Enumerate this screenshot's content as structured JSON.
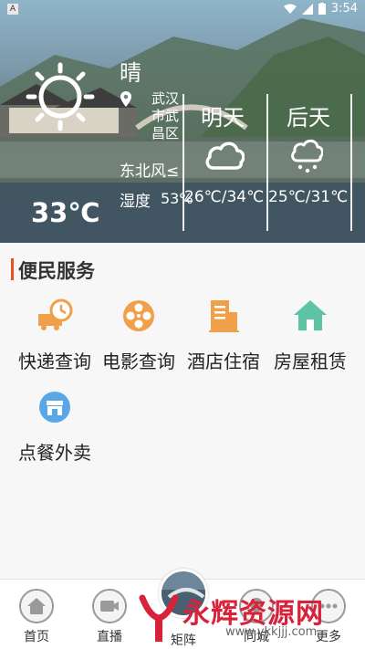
{
  "status_bar": {
    "time": "3:54",
    "notification_badge": "A"
  },
  "weather": {
    "today": {
      "condition": "晴",
      "location": "武汉市武昌区",
      "wind": "东北风≤",
      "humidity_label": "湿度",
      "humidity_value": "53%",
      "temperature": "33℃",
      "icon": "sun-icon"
    },
    "forecast": [
      {
        "day": "明天",
        "temp_range": "26℃/34℃",
        "icon": "cloud-icon"
      },
      {
        "day": "后天",
        "temp_range": "25℃/31℃",
        "icon": "rain-cloud-icon"
      }
    ]
  },
  "services": {
    "title": "便民服务",
    "accent_color": "#e8502a",
    "items": [
      {
        "label": "快递查询",
        "icon": "delivery-truck-icon",
        "color": "#f0a04b"
      },
      {
        "label": "电影查询",
        "icon": "film-reel-icon",
        "color": "#f0a04b"
      },
      {
        "label": "酒店住宿",
        "icon": "hotel-building-icon",
        "color": "#f0a04b"
      },
      {
        "label": "房屋租赁",
        "icon": "house-icon",
        "color": "#5cc3a5"
      },
      {
        "label": "点餐外卖",
        "icon": "takeout-shop-icon",
        "color": "#5aa7e8"
      }
    ]
  },
  "bottom_nav": {
    "items": [
      {
        "label": "首页",
        "icon": "home-icon"
      },
      {
        "label": "直播",
        "icon": "video-camera-icon"
      },
      {
        "label": "矩阵",
        "icon": "matrix-avatar-icon"
      },
      {
        "label": "同城",
        "icon": "location-icon"
      },
      {
        "label": "更多",
        "icon": "more-icon"
      }
    ]
  },
  "watermark": {
    "text": "永辉资源网",
    "url": "www.ykkjjj.com"
  }
}
